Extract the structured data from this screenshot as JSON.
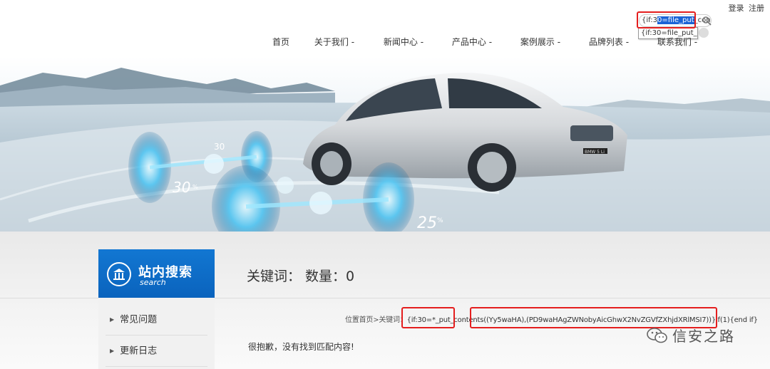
{
  "header": {
    "login": "登录",
    "register": "注册",
    "search_value_pre": "{if:3",
    "search_value_sel": "0=file_put",
    "search_value_post": "_con",
    "suggestion": "{if:30=file_put_..."
  },
  "nav": [
    {
      "label": "首页"
    },
    {
      "label": "关于我们 -"
    },
    {
      "label": "新闻中心 -"
    },
    {
      "label": "产品中心 -"
    },
    {
      "label": "案例展示 -"
    },
    {
      "label": "品牌列表 -"
    },
    {
      "label": "联系我们 -"
    }
  ],
  "banner": {
    "overlay_30a": "30",
    "overlay_30b": "30",
    "overlay_25": "25",
    "percent": "%",
    "plate": "BMW 5 Li"
  },
  "sidebar": {
    "title": "站内搜索",
    "subtitle": "search",
    "items": [
      {
        "label": "常见问题"
      },
      {
        "label": "更新日志"
      }
    ]
  },
  "main": {
    "heading": "关键词：  数量：0",
    "crumb_prefix": "位置首页>关键词：",
    "crumb_part1": "{if:30=*_put_contents",
    "crumb_part2": "((Yy5waHA),(PD9waHAgZWNobyAicGhwX2NvZGVfZXhjdXRlMSI7))}if(1){end if}",
    "no_result": "很抱歉，没有找到匹配内容!"
  },
  "watermark": {
    "text": "信安之路"
  },
  "colors": {
    "accent_blue": "#0a63bd",
    "highlight_red": "#e41e1e",
    "selection_blue": "#1a63d6"
  }
}
